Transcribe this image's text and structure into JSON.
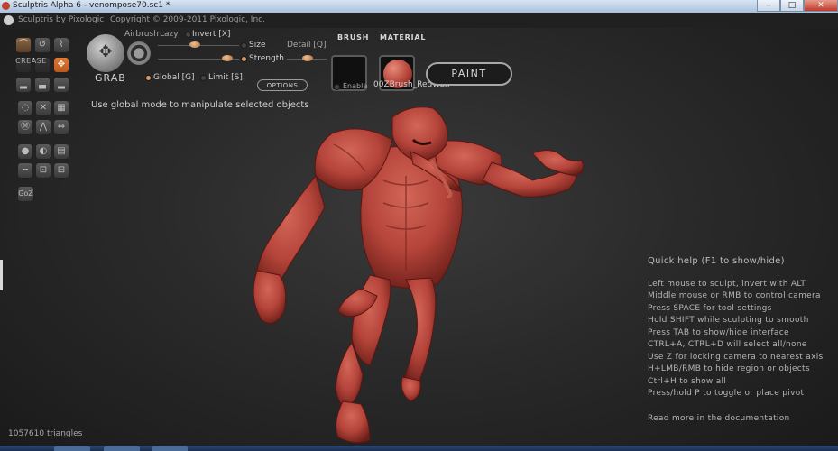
{
  "window": {
    "title": "Sculptris Alpha 6 - venompose70.sc1 *",
    "min": "‒",
    "max": "□",
    "close": "✕"
  },
  "header": {
    "app_name": "Sculptris by Pixologic",
    "copyright": "Copyright © 2009-2011 Pixologic, Inc."
  },
  "tools": {
    "crease_label": "CREASE",
    "goz_label": "GoZ"
  },
  "grab": {
    "label": "GRAB",
    "airbrush": "Airbrush",
    "lazy": "Lazy",
    "invert": "Invert [X]",
    "size": "Size",
    "detail": "Detail [Q]",
    "strength": "Strength",
    "options": "OPTIONS",
    "global": "Global [G]",
    "limit": "Limit [S]"
  },
  "brush": {
    "title": "BRUSH",
    "enable": "Enable"
  },
  "material": {
    "title": "MATERIAL",
    "name": "00ZBrush_RedWax"
  },
  "paint_label": "PAINT",
  "hint": "Use global mode to manipulate selected objects",
  "quick_help": {
    "title": "Quick help (F1 to show/hide)",
    "lines": [
      "Left mouse to sculpt, invert with ALT",
      "Middle mouse or RMB to control camera",
      "Press SPACE for tool settings",
      "Hold SHIFT while sculpting to smooth",
      "Press TAB to show/hide interface",
      "CTRL+A, CTRL+D will select all/none",
      "Use Z for locking camera to nearest axis",
      "H+LMB/RMB to hide region or objects",
      "Ctrl+H to show all",
      "Press/hold P to toggle or place pivot"
    ],
    "more": "Read more in the documentation"
  },
  "status": {
    "triangles": "1057610 triangles"
  },
  "colors": {
    "wax": "#b5443a",
    "accent": "#d99b6b",
    "tool_orange": "#e07a35"
  }
}
